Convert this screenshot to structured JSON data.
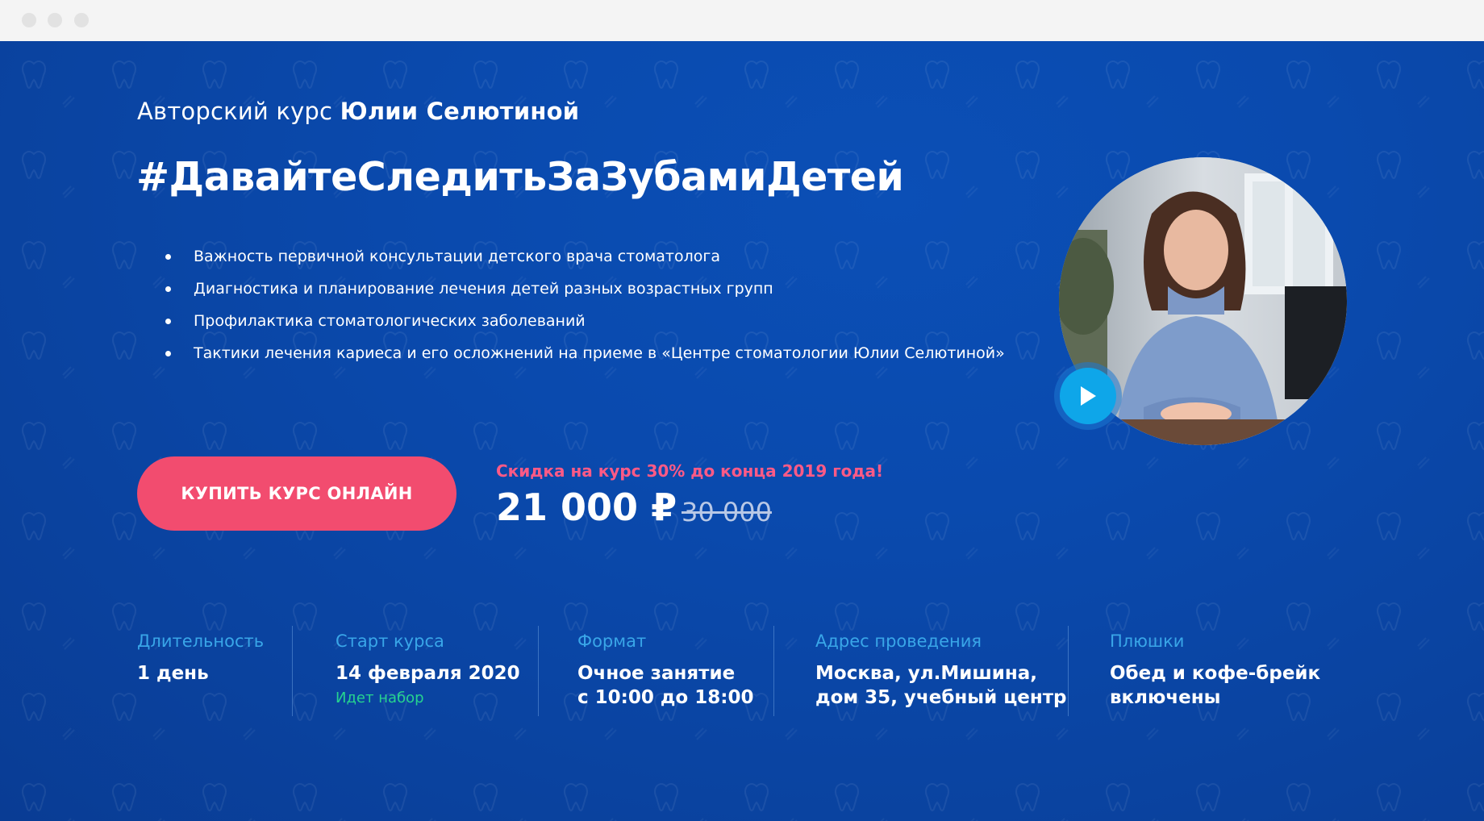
{
  "window": {
    "controls": [
      "dot-1",
      "dot-2",
      "dot-3"
    ]
  },
  "hero": {
    "subtitle_prefix": "Авторский курс",
    "subtitle_author": "Юлии Селютиной",
    "headline": "#ДавайтеСледитьЗаЗубамиДетей",
    "bullets": [
      "Важность первичной консультации детского врача стоматолога",
      "Диагностика и планирование лечения детей разных возрастных групп",
      "Профилактика стоматологических заболеваний",
      "Тактики лечения кариеса и его осложнений на приеме в «Центре стоматологии Юлии Селютиной»"
    ],
    "photo_alt": "portrait",
    "play_icon": "play-icon"
  },
  "cta": {
    "buy_label": "КУПИТЬ КУРС ОНЛАЙН",
    "discount_text": "Скидка на курс 30% до конца 2019 года!",
    "price": "21 000 ₽",
    "old_price": "30 000"
  },
  "info": {
    "duration_label": "Длительность",
    "duration_value": "1 день",
    "start_label": "Старт курса",
    "start_value": "14 февраля 2020",
    "start_note": "Идет набор",
    "format_label": "Формат",
    "format_value_line1": "Очное занятие",
    "format_value_line2": "с 10:00 до 18:00",
    "address_label": "Адрес проведения",
    "address_value_line1": "Москва, ул.Мишина,",
    "address_value_line2": "дом 35, учебный центр",
    "extras_label": "Плюшки",
    "extras_value_line1": "Обед и кофе-брейк",
    "extras_value_line2": "включены"
  },
  "colors": {
    "background": "#0a4aae",
    "accent_button": "#f24c6f",
    "discount_text": "#ff5a86",
    "info_label": "#39a6e8",
    "status_green": "#26d38f",
    "play_button": "#0ea6e9"
  }
}
